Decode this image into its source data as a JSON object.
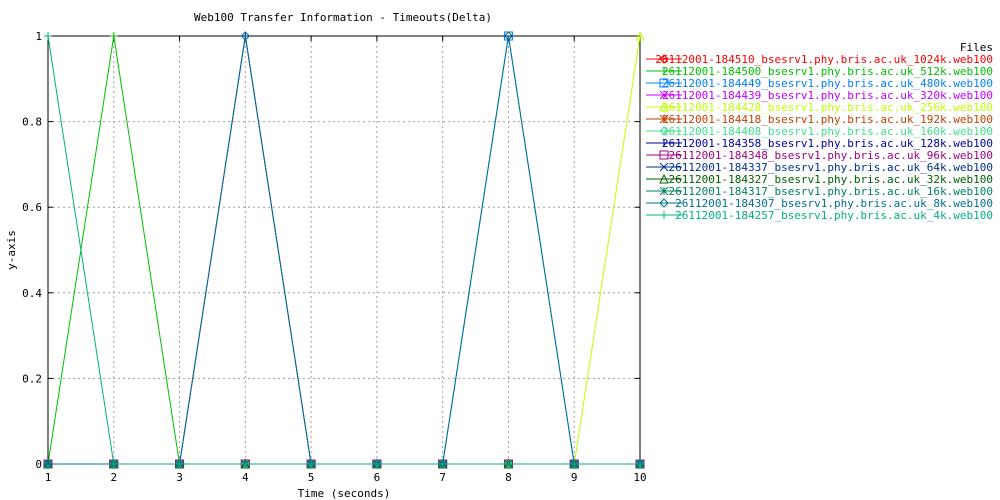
{
  "chart_data": {
    "type": "line",
    "title": "Web100 Transfer Information - Timeouts(Delta)",
    "xlabel": "Time (seconds)",
    "ylabel": "y-axis",
    "xlim": [
      1,
      10
    ],
    "ylim": [
      0,
      1
    ],
    "x_ticks": [
      "1",
      "2",
      "3",
      "4",
      "5",
      "6",
      "7",
      "8",
      "9",
      "10"
    ],
    "y_ticks": [
      "0",
      "0.2",
      "0.4",
      "0.6",
      "0.8",
      "1"
    ],
    "grid": true,
    "legend_title": "Files",
    "legend_position": "right",
    "x": [
      1,
      2,
      3,
      4,
      5,
      6,
      7,
      8,
      9,
      10
    ],
    "series": [
      {
        "name": "26112001-184510_bsesrv1.phy.bris.ac.uk_1024k.web100",
        "color": "#ff0000",
        "marker": "diamond",
        "values": [
          0,
          0,
          0,
          0,
          0,
          0,
          0,
          0,
          0,
          0
        ]
      },
      {
        "name": "26112001-184500_bsesrv1.phy.bris.ac.uk_512k.web100",
        "color": "#00c000",
        "marker": "plus",
        "values": [
          0,
          1,
          0,
          0,
          0,
          0,
          0,
          0,
          0,
          0
        ]
      },
      {
        "name": "26112001-184449_bsesrv1.phy.bris.ac.uk_480k.web100",
        "color": "#0080ff",
        "marker": "square",
        "values": [
          0,
          0,
          0,
          0,
          0,
          0,
          0,
          1,
          0,
          0
        ]
      },
      {
        "name": "26112001-184439_bsesrv1.phy.bris.ac.uk_320k.web100",
        "color": "#c000ff",
        "marker": "x",
        "values": [
          0,
          0,
          0,
          0,
          0,
          0,
          0,
          0,
          0,
          0
        ]
      },
      {
        "name": "26112001-184428_bsesrv1.phy.bris.ac.uk_256k.web100",
        "color": "#c0ff00",
        "marker": "triangle",
        "values": [
          0,
          0,
          0,
          0,
          0,
          0,
          0,
          0,
          0,
          1
        ]
      },
      {
        "name": "26112001-184418_bsesrv1.phy.bris.ac.uk_192k.web100",
        "color": "#c04000",
        "marker": "star",
        "values": [
          0,
          0,
          0,
          0,
          0,
          0,
          0,
          0,
          0,
          0
        ]
      },
      {
        "name": "26112001-184408_bsesrv1.phy.bris.ac.uk_160k.web100",
        "color": "#40e090",
        "marker": "diamond",
        "values": [
          0,
          0,
          0,
          0,
          0,
          0,
          0,
          0,
          0,
          0
        ]
      },
      {
        "name": "26112001-184358_bsesrv1.phy.bris.ac.uk_128k.web100",
        "color": "#0000a0",
        "marker": "plus",
        "values": [
          0,
          0,
          0,
          1,
          0,
          0,
          0,
          0,
          0,
          0
        ]
      },
      {
        "name": "26112001-184348_bsesrv1.phy.bris.ac.uk_96k.web100",
        "color": "#a00080",
        "marker": "square",
        "values": [
          0,
          0,
          0,
          0,
          0,
          0,
          0,
          0,
          0,
          0
        ]
      },
      {
        "name": "26112001-184337_bsesrv1.phy.bris.ac.uk_64k.web100",
        "color": "#003090",
        "marker": "x",
        "values": [
          0,
          0,
          0,
          0,
          0,
          0,
          0,
          0,
          0,
          0
        ]
      },
      {
        "name": "26112001-184327_bsesrv1.phy.bris.ac.uk_32k.web100",
        "color": "#006000",
        "marker": "triangle",
        "values": [
          0,
          0,
          0,
          0,
          0,
          0,
          0,
          0,
          0,
          0
        ]
      },
      {
        "name": "26112001-184317_bsesrv1.phy.bris.ac.uk_16k.web100",
        "color": "#008060",
        "marker": "star",
        "values": [
          0,
          0,
          0,
          0,
          0,
          0,
          0,
          0,
          0,
          0
        ]
      },
      {
        "name": "26112001-184307_bsesrv1.phy.bris.ac.uk_8k.web100",
        "color": "#007090",
        "marker": "diamond",
        "values": [
          0,
          0,
          0,
          1,
          0,
          0,
          0,
          1,
          0,
          0
        ]
      },
      {
        "name": "26112001-184257_bsesrv1.phy.bris.ac.uk_4k.web100",
        "color": "#00b080",
        "marker": "plus",
        "values": [
          1,
          0,
          0,
          0,
          0,
          0,
          0,
          0,
          0,
          0
        ]
      }
    ]
  }
}
